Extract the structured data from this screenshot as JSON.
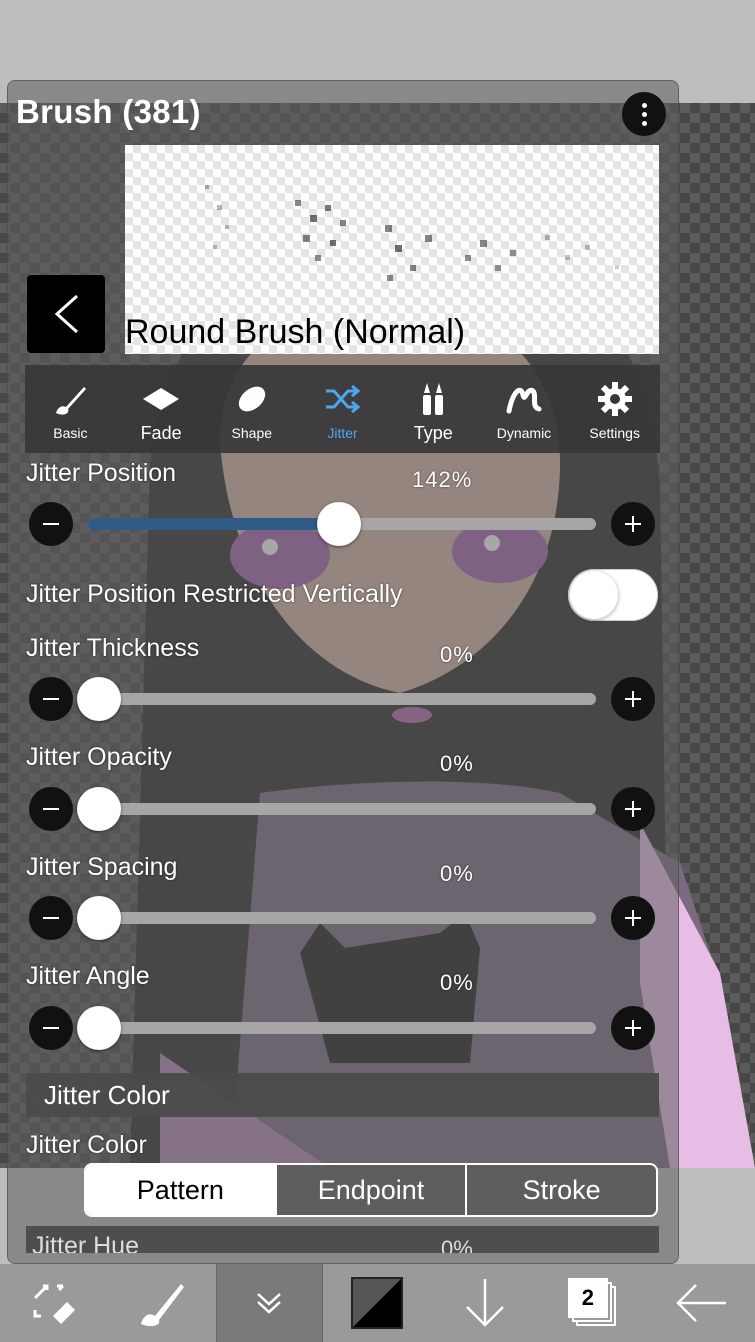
{
  "panel": {
    "title": "Brush (381)",
    "brush_name": "Round Brush (Normal)"
  },
  "tabs": [
    {
      "label": "Basic",
      "icon": "brush-icon"
    },
    {
      "label": "Fade",
      "icon": "diamond-icon"
    },
    {
      "label": "Shape",
      "icon": "ellipse-icon"
    },
    {
      "label": "Jitter",
      "icon": "shuffle-icon",
      "active": true
    },
    {
      "label": "Type",
      "icon": "brush-type-icon"
    },
    {
      "label": "Dynamic",
      "icon": "squiggle-icon"
    },
    {
      "label": "Settings",
      "icon": "gear-icon"
    }
  ],
  "settings": {
    "jitter_position": {
      "label": "Jitter Position",
      "value": "142%",
      "level": 0.5
    },
    "restricted_vertically": {
      "label": "Jitter Position Restricted Vertically",
      "on": false
    },
    "jitter_thickness": {
      "label": "Jitter Thickness",
      "value": "0%",
      "level": 0
    },
    "jitter_opacity": {
      "label": "Jitter Opacity",
      "value": "0%",
      "level": 0
    },
    "jitter_spacing": {
      "label": "Jitter Spacing",
      "value": "0%",
      "level": 0
    },
    "jitter_angle": {
      "label": "Jitter Angle",
      "value": "0%",
      "level": 0
    }
  },
  "jitter_color": {
    "section_title": "Jitter Color",
    "label": "Jitter Color",
    "options": [
      "Pattern",
      "Endpoint",
      "Stroke"
    ],
    "selected": "Pattern",
    "next_label": "Jitter Hue",
    "next_value": "0%"
  },
  "toolbar": {
    "items": [
      "transform-icon",
      "brush-icon",
      "collapse-icon",
      "color-icon",
      "download-icon",
      "layers-icon",
      "back-arrow-icon"
    ],
    "layers_count": "2"
  },
  "colors": {
    "accent": "#4aa8f0",
    "slider_fill": "#2f5b86"
  }
}
